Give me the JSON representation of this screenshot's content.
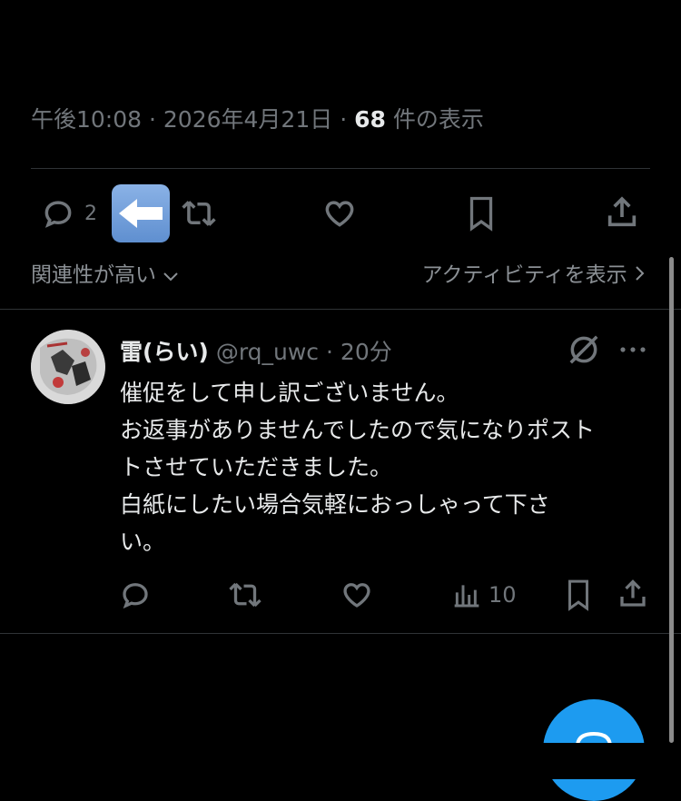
{
  "tweet_meta": {
    "time": "午後10:08",
    "sep1": "·",
    "date": "2026年4月21日",
    "sep2": "·",
    "views_count": "68",
    "views_label": "件の表示"
  },
  "main_actions": {
    "reply_count": "2",
    "arrow_emoji": "⬅️"
  },
  "replies_header": {
    "sort_label": "関連性が高い",
    "activity_label": "アクティビティを表示"
  },
  "reply": {
    "name": "雷(らい)",
    "handle": "@rq_uwc",
    "sep": "·",
    "time": "20分",
    "lines": [
      "催促をして申し訳ございません。",
      "お返事がありませんでしたので気になりポスト",
      "トさせていただきました。",
      "白紙にしたい場合気軽におっしゃって下さ",
      "い。"
    ],
    "views_count": "10"
  },
  "colors": {
    "background": "#000000",
    "text": "#e7e9ea",
    "muted": "#71767b",
    "divider": "#2f3336",
    "accent": "#1d9bf0"
  },
  "icons": [
    "reply-icon",
    "retweet-icon",
    "like-icon",
    "bookmark-icon",
    "share-icon",
    "grok-icon",
    "more-icon",
    "analytics-icon",
    "chevron-down-icon",
    "chevron-right-icon"
  ]
}
